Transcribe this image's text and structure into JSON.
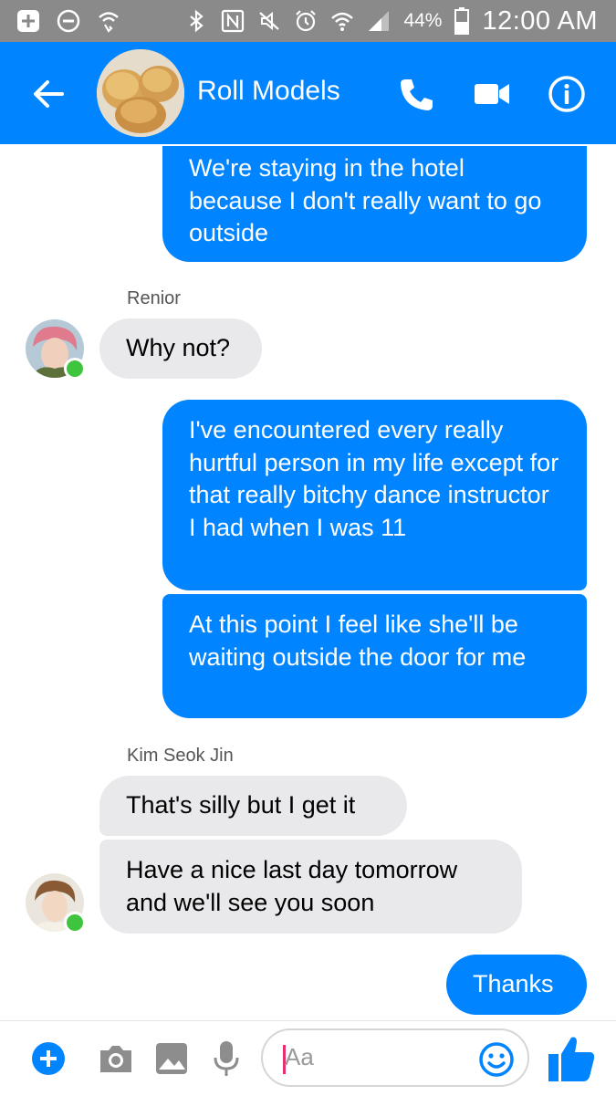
{
  "status_bar": {
    "battery_percent": "44%",
    "time": "12:00 AM",
    "icons": [
      "add-icon",
      "minus-circle-icon",
      "wifi-calling-icon",
      "bluetooth-icon",
      "nfc-icon",
      "mute-icon",
      "alarm-icon",
      "wifi-icon",
      "signal-icon",
      "battery-icon"
    ]
  },
  "header": {
    "title": "Roll Models",
    "icons": [
      "back-arrow-icon",
      "phone-icon",
      "video-camera-icon",
      "info-icon"
    ]
  },
  "messages": [
    {
      "direction": "out",
      "text": "We're staying in the hotel because I don't really want to go outside"
    },
    {
      "direction": "in",
      "sender": "Renior",
      "text": "Why not?"
    },
    {
      "direction": "out",
      "text": "I've encountered every really hurtful person in my life except for that really bitchy dance instructor I had when I was 11"
    },
    {
      "direction": "out",
      "text": "At this point I feel like she'll be waiting outside the door for me"
    },
    {
      "direction": "in",
      "sender": "Kim Seok Jin",
      "text": "That's silly but I get it"
    },
    {
      "direction": "in",
      "text": "Have a nice last day tomorrow and we'll see you soon"
    },
    {
      "direction": "out",
      "text": "Thanks"
    }
  ],
  "composer": {
    "placeholder": "Aa",
    "icons": [
      "plus-icon",
      "camera-icon",
      "image-icon",
      "microphone-icon",
      "emoji-icon",
      "thumbs-up-icon"
    ]
  },
  "colors": {
    "accent": "#0084ff",
    "status_bar": "#8a8a8a",
    "incoming_bubble": "#e9e9eb",
    "online": "#3ec43e"
  }
}
